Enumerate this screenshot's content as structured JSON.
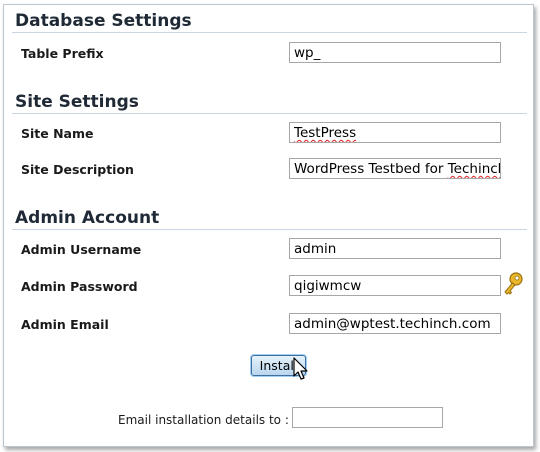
{
  "database": {
    "title": "Database Settings",
    "table_prefix_label": "Table Prefix",
    "table_prefix_value": "wp_"
  },
  "site": {
    "title": "Site Settings",
    "site_name_label": "Site Name",
    "site_name_value": "TestPress",
    "site_description_label": "Site Description",
    "site_description_prefix": "WordPress Testbed for ",
    "site_description_spell": "Techinch"
  },
  "admin": {
    "title": "Admin Account",
    "username_label": "Admin Username",
    "username_value": "admin",
    "password_label": "Admin Password",
    "password_value": "qigiwmcw",
    "email_label": "Admin Email",
    "email_value": "admin@wptest.techinch.com"
  },
  "actions": {
    "install_label": "Install"
  },
  "email_details": {
    "label": "Email installation details to :",
    "value": ""
  },
  "icons": {
    "password_generator": "key-icon",
    "pointer": "cursor-icon"
  }
}
